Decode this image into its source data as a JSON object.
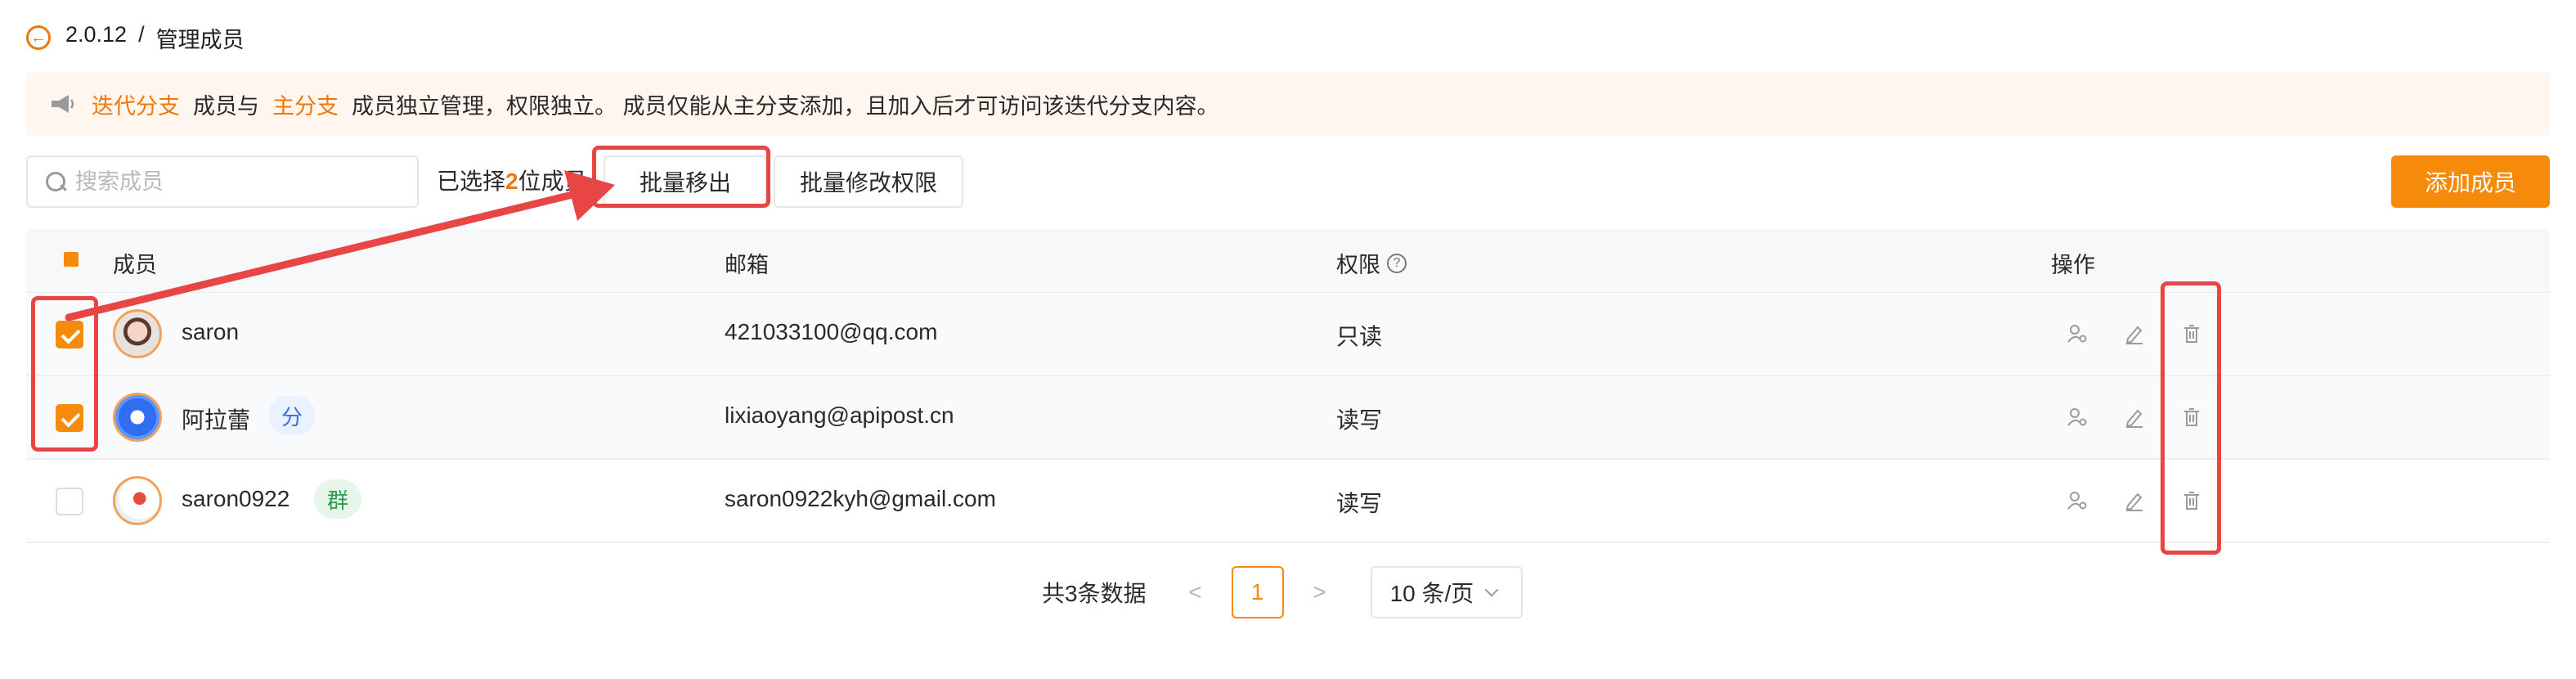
{
  "header": {
    "version": "2.0.12",
    "separator": "/",
    "title": "管理成员"
  },
  "notice": {
    "icon": "megaphone-icon",
    "highlight1": "迭代分支",
    "text1": "成员与",
    "highlight2": "主分支",
    "text2": "成员独立管理，权限独立。 成员仅能从主分支添加，且加入后才可访问该迭代分支内容。"
  },
  "toolbar": {
    "search_placeholder": "搜索成员",
    "selected_prefix": "已选择",
    "selected_count": "2",
    "selected_suffix": "位成员",
    "remove_label": "批量移出",
    "perm_label": "批量修改权限",
    "add_label": "添加成员"
  },
  "table": {
    "columns": {
      "member": "成员",
      "email": "邮箱",
      "permission": "权限",
      "actions": "操作"
    },
    "rows": [
      {
        "name": "saron",
        "tag": "",
        "email": "421033100@qq.com",
        "permission": "只读",
        "checked": true
      },
      {
        "name": "阿拉蕾",
        "tag": "分",
        "email": "lixiaoyang@apipost.cn",
        "permission": "读写",
        "checked": true
      },
      {
        "name": "saron0922",
        "tag": "群",
        "email": "saron0922kyh@gmail.com",
        "permission": "读写",
        "checked": false
      }
    ]
  },
  "pagination": {
    "total": "共3条数据",
    "prev": "<",
    "page": "1",
    "next": ">",
    "page_size": "10 条/页"
  },
  "colors": {
    "accent": "#f58a0b",
    "annotation": "#e84545",
    "notice_bg": "#fff6ef"
  }
}
